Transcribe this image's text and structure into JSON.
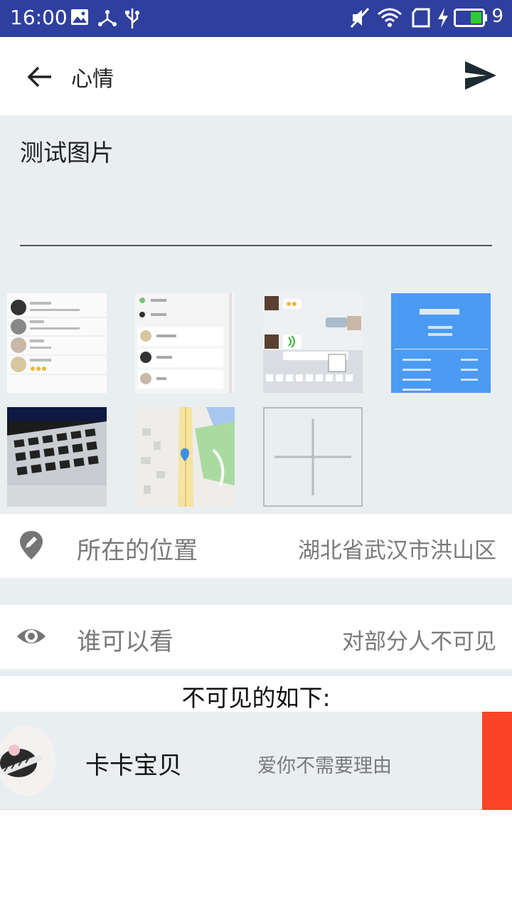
{
  "status_bar": {
    "time": "16:00",
    "battery_level": "9",
    "icons": [
      "image-icon",
      "usb-share-icon",
      "usb-icon",
      "mute-icon",
      "wifi-icon",
      "sim-icon",
      "charging-icon",
      "battery-icon"
    ]
  },
  "toolbar": {
    "title": "心情",
    "back_icon": "arrow-left-icon",
    "send_icon": "send-icon"
  },
  "editor": {
    "text": "测试图片"
  },
  "images": [
    {
      "name": "chat-list-screenshot"
    },
    {
      "name": "group-list-screenshot"
    },
    {
      "name": "keyboard-chat-screenshot"
    },
    {
      "name": "weather-screenshot"
    },
    {
      "name": "laptop-keyboard-photo"
    },
    {
      "name": "map-screenshot"
    }
  ],
  "add_image": {
    "icon": "plus-icon"
  },
  "location": {
    "label": "所在的位置",
    "value": "湖北省武汉市洪山区",
    "icon": "location-pin-icon"
  },
  "visibility": {
    "label": "谁可以看",
    "value": "对部分人不可见",
    "icon": "eye-icon"
  },
  "hidden_list": {
    "title": "不可见的如下:",
    "items": [
      {
        "name": "卡卡宝贝",
        "signature": "爱你不需要理由"
      }
    ]
  },
  "colors": {
    "status_bar": "#2f3f9e",
    "section_bg": "#e9eef1",
    "delete_red": "#fb4427"
  }
}
